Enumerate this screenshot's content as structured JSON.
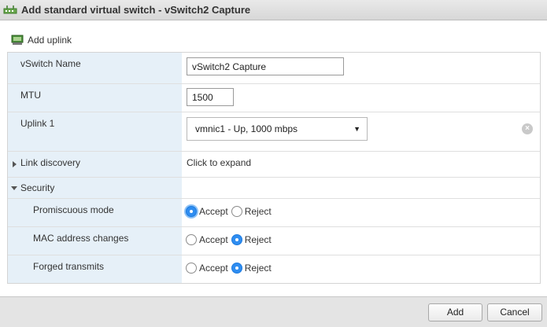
{
  "window": {
    "title": "Add standard virtual switch - vSwitch2 Capture",
    "icon": "vswitch-icon"
  },
  "toolbar": {
    "add_uplink_label": "Add uplink",
    "icon": "network-adapter-icon"
  },
  "form": {
    "vswitch_name": {
      "label": "vSwitch Name",
      "value": "vSwitch2 Capture"
    },
    "mtu": {
      "label": "MTU",
      "value": "1500"
    },
    "uplink1": {
      "label": "Uplink 1",
      "value": "vmnic1 - Up, 1000 mbps"
    },
    "link_discovery": {
      "label": "Link discovery",
      "value": "Click to expand",
      "expanded": false
    },
    "security": {
      "label": "Security",
      "expanded": true,
      "promiscuous_mode": {
        "label": "Promiscuous mode",
        "accept": "Accept",
        "reject": "Reject",
        "selected": "Accept"
      },
      "mac_address_changes": {
        "label": "MAC address changes",
        "accept": "Accept",
        "reject": "Reject",
        "selected": "Reject"
      },
      "forged_transmits": {
        "label": "Forged transmits",
        "accept": "Accept",
        "reject": "Reject",
        "selected": "Reject"
      }
    }
  },
  "footer": {
    "add_label": "Add",
    "cancel_label": "Cancel"
  },
  "colors": {
    "label_bg": "#e6f0f8",
    "radio_checked": "#2f8df0",
    "footer_bg": "#e4e4e4"
  }
}
